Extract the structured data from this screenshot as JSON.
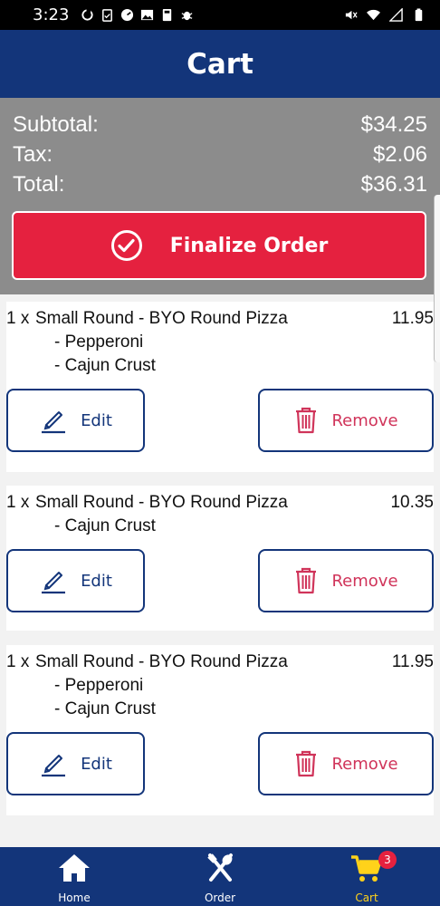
{
  "status_bar": {
    "time": "3:23",
    "left_icons": [
      "sync-icon",
      "clipboard-icon",
      "speedometer-icon",
      "image-icon",
      "calculator-icon",
      "bug-icon"
    ],
    "right_icons": [
      "mute-icon",
      "wifi-icon",
      "signal-icon",
      "battery-icon"
    ]
  },
  "header": {
    "title": "Cart"
  },
  "summary": {
    "subtotal_label": "Subtotal:",
    "subtotal_value": "$34.25",
    "tax_label": "Tax:",
    "tax_value": "$2.06",
    "total_label": "Total:",
    "total_value": "$36.31"
  },
  "finalize": {
    "label": "Finalize Order",
    "icon": "check-circle-icon"
  },
  "items": [
    {
      "qty": "1 x",
      "name": "Small Round - BYO Round Pizza",
      "price": "11.95",
      "mods": [
        "- Pepperoni",
        "- Cajun Crust"
      ],
      "edit_label": "Edit",
      "remove_label": "Remove"
    },
    {
      "qty": "1 x",
      "name": "Small Round - BYO Round Pizza",
      "price": "10.35",
      "mods": [
        "- Cajun Crust"
      ],
      "edit_label": "Edit",
      "remove_label": "Remove"
    },
    {
      "qty": "1 x",
      "name": "Small Round - BYO Round Pizza",
      "price": "11.95",
      "mods": [
        "- Pepperoni",
        "- Cajun Crust"
      ],
      "edit_label": "Edit",
      "remove_label": "Remove"
    }
  ],
  "nav": {
    "home": {
      "label": "Home",
      "icon": "home-icon"
    },
    "order": {
      "label": "Order",
      "icon": "utensils-icon"
    },
    "cart": {
      "label": "Cart",
      "icon": "cart-icon",
      "badge": "3"
    }
  },
  "colors": {
    "brand": "#13357a",
    "accent": "#e5213f",
    "summary_bg": "#8c8c8c",
    "remove": "#d0345a",
    "active_nav": "#ffd21a"
  }
}
